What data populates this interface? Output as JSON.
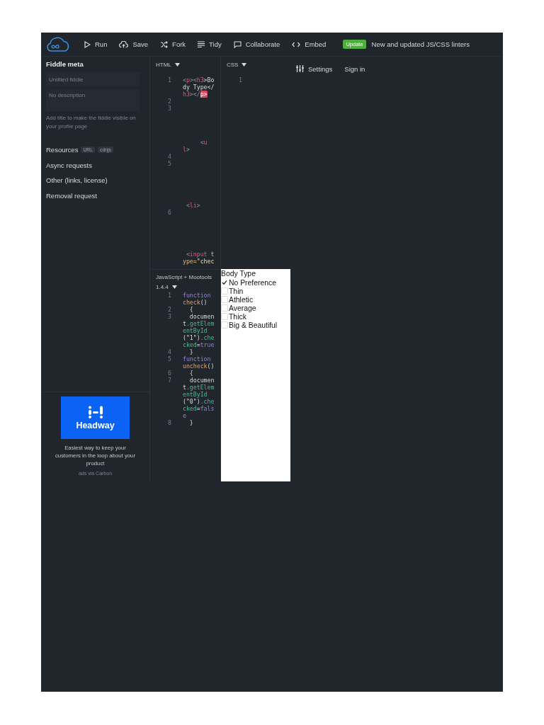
{
  "toolbar": {
    "actions": [
      {
        "label": "Run",
        "kind": "run"
      },
      {
        "label": "Save",
        "kind": "save"
      },
      {
        "label": "Fork",
        "kind": "fork"
      },
      {
        "label": "Tidy",
        "kind": "tidy"
      },
      {
        "label": "Collaborate",
        "kind": "collaborate"
      },
      {
        "label": "Embed",
        "kind": "embed"
      }
    ],
    "badge": "Update",
    "news": "New and updated JS/CSS linters",
    "settings": "Settings",
    "sign_in": "Sign in"
  },
  "sidebar": {
    "title": "Fiddle meta",
    "title_field": {
      "placeholder": "Untitled fiddle"
    },
    "description_field": {
      "placeholder": "No description"
    },
    "hint": "Add title to make the fiddle visible on your profile page",
    "links": [
      {
        "label": "Resources",
        "tags": [
          "URL",
          "cdnjs"
        ]
      },
      {
        "label": "Async requests"
      },
      {
        "label": "Other (links, license)"
      },
      {
        "label": "Removal request"
      }
    ],
    "ad": {
      "brand": "Headway",
      "text": "Easiest way to keep your customers in the loop about your product",
      "credit": "ads via Carbon"
    }
  },
  "html_panel": {
    "label": "HTML",
    "code": [
      {
        "number": "1",
        "tokens": [
          {
            "text": "<",
            "kind": "punct"
          },
          {
            "text": "p",
            "kind": "tag"
          },
          {
            "text": "><",
            "kind": "punct"
          },
          {
            "text": "h3",
            "kind": "tag"
          },
          {
            "text": ">Bo",
            "kind": "plain"
          }
        ]
      },
      {
        "tokens": [
          {
            "text": "dy Type</",
            "kind": "plain"
          }
        ]
      },
      {
        "tokens": [
          {
            "text": "h3",
            "kind": "tag"
          },
          {
            "text": "></",
            "kind": "punct"
          },
          {
            "text": "p>",
            "kind": "error"
          }
        ]
      },
      {
        "number": "2"
      },
      {
        "number": "3"
      },
      {
        "tokens": [
          {
            "text": "     <",
            "kind": "punct"
          },
          {
            "text": "u",
            "kind": "tag"
          }
        ]
      },
      {
        "tokens": [
          {
            "text": "l",
            "kind": "tag"
          },
          {
            "text": ">",
            "kind": "punct"
          }
        ]
      },
      {
        "number": "4"
      },
      {
        "number": "5"
      },
      {
        "tokens": [
          {
            "text": " <",
            "kind": "punct"
          },
          {
            "text": "li",
            "kind": "tag"
          },
          {
            "text": ">",
            "kind": "punct"
          }
        ]
      },
      {
        "number": "6"
      },
      {
        "tokens": [
          {
            "text": " <",
            "kind": "punct"
          },
          {
            "text": "input",
            "kind": "tag"
          },
          {
            "text": " t",
            "kind": "attr"
          }
        ]
      },
      {
        "tokens": [
          {
            "text": "ype=",
            "kind": "attr"
          },
          {
            "text": "\"chec",
            "kind": "string"
          }
        ]
      }
    ]
  },
  "css_panel": {
    "label": "CSS",
    "code": [
      {
        "number": "1"
      }
    ]
  },
  "js_panel": {
    "label": "JavaScript + Mootools",
    "version": "1.4.4",
    "code": [
      {
        "number": "1",
        "tokens": [
          {
            "text": "function",
            "kind": "keyword"
          }
        ]
      },
      {
        "tokens": [
          {
            "text": "check",
            "kind": "name"
          },
          {
            "text": "()",
            "kind": "plain"
          }
        ]
      },
      {
        "number": "2",
        "tokens": [
          {
            "text": "  {",
            "kind": "plain"
          }
        ]
      },
      {
        "number": "3",
        "tokens": [
          {
            "text": "  documen",
            "kind": "plain"
          }
        ]
      },
      {
        "tokens": [
          {
            "text": "t",
            "kind": "plain"
          },
          {
            "text": ".getElem",
            "kind": "method"
          }
        ]
      },
      {
        "tokens": [
          {
            "text": "entById",
            "kind": "method"
          }
        ]
      },
      {
        "tokens": [
          {
            "text": "(\"1\")",
            "kind": "plain"
          },
          {
            "text": ".che",
            "kind": "method"
          }
        ]
      },
      {
        "tokens": [
          {
            "text": "cked",
            "kind": "method"
          },
          {
            "text": "=",
            "kind": "plain"
          },
          {
            "text": "true",
            "kind": "keyword"
          }
        ]
      },
      {
        "number": "4",
        "tokens": [
          {
            "text": "  }",
            "kind": "plain"
          }
        ]
      },
      {
        "number": "5",
        "tokens": [
          {
            "text": "function",
            "kind": "keyword"
          }
        ]
      },
      {
        "tokens": [
          {
            "text": "uncheck",
            "kind": "name"
          },
          {
            "text": "()",
            "kind": "plain"
          }
        ]
      },
      {
        "number": "6",
        "tokens": [
          {
            "text": "  {",
            "kind": "plain"
          }
        ]
      },
      {
        "number": "7",
        "tokens": [
          {
            "text": "  documen",
            "kind": "plain"
          }
        ]
      },
      {
        "tokens": [
          {
            "text": "t",
            "kind": "plain"
          },
          {
            "text": ".getElem",
            "kind": "method"
          }
        ]
      },
      {
        "tokens": [
          {
            "text": "entById",
            "kind": "method"
          }
        ]
      },
      {
        "tokens": [
          {
            "text": "(\"0\")",
            "kind": "plain"
          },
          {
            "text": ".che",
            "kind": "method"
          }
        ]
      },
      {
        "tokens": [
          {
            "text": "cked",
            "kind": "method"
          },
          {
            "text": "=",
            "kind": "plain"
          },
          {
            "text": "fals",
            "kind": "keyword"
          }
        ]
      },
      {
        "tokens": [
          {
            "text": "e",
            "kind": "keyword"
          }
        ]
      },
      {
        "number": "8",
        "tokens": [
          {
            "text": "  }",
            "kind": "plain"
          }
        ]
      }
    ]
  },
  "result": {
    "heading": "Body Type",
    "options": [
      {
        "label": "No Preference",
        "checked": true
      },
      {
        "label": "Thin",
        "checked": false
      },
      {
        "label": "Athletic",
        "checked": false
      },
      {
        "label": "Average",
        "checked": false
      },
      {
        "label": "Thick",
        "checked": false
      },
      {
        "label": "Big & Beautiful",
        "checked": false
      }
    ]
  }
}
